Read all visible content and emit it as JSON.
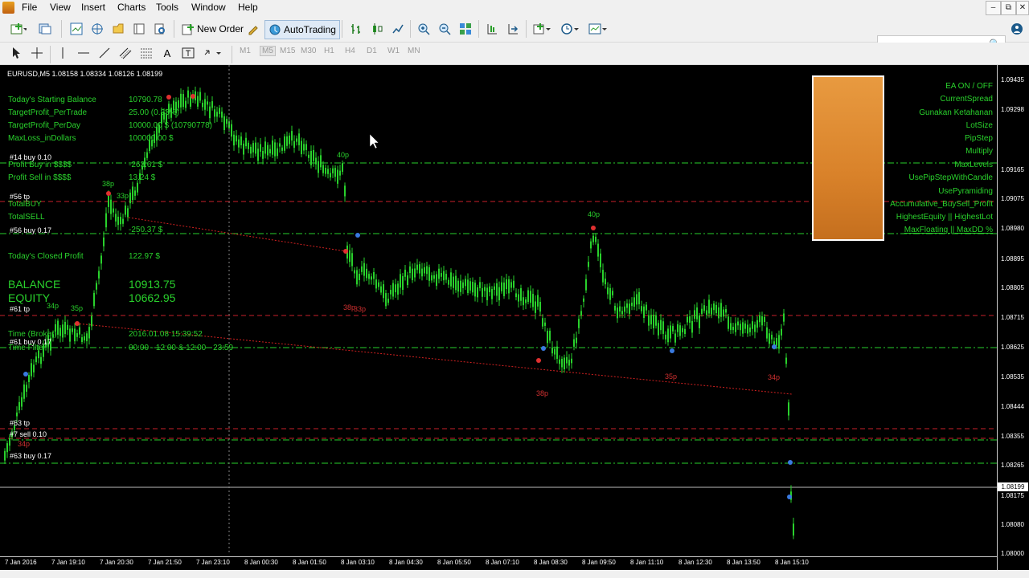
{
  "menu": {
    "items": [
      "File",
      "View",
      "Insert",
      "Charts",
      "Tools",
      "Window",
      "Help"
    ]
  },
  "window_controls": {
    "minimize": "–",
    "restore": "⧉",
    "close": "✕"
  },
  "toolbar": {
    "new_order": "New Order",
    "autotrading": "AutoTrading",
    "timeframes": [
      "M1",
      "M5",
      "M15",
      "M30",
      "H1",
      "H4",
      "D1",
      "W1",
      "MN"
    ]
  },
  "search": {
    "placeholder": ""
  },
  "chart": {
    "header": "EURUSD,M5  1.08158 1.08334 1.08126 1.08199",
    "info": [
      {
        "label": "Today's Starting Balance",
        "value": "10790.78"
      },
      {
        "label": "TargetProfit_PerTrade",
        "value": "25.00 (0.23%)"
      },
      {
        "label": "TargetProfit_PerDay",
        "value": "10000.00 $ (10790778)"
      },
      {
        "label": "MaxLoss_inDollars",
        "value": "100000.00 $"
      }
    ],
    "profit_buy": {
      "label": "Profit Buy in $$$$",
      "value": "-263.61 $"
    },
    "profit_sell": {
      "label": "Profit Sell in $$$$",
      "value": "13.24 $"
    },
    "total_buy": "TotalBUY",
    "total_sell": "TotalSELL",
    "total_value": "-250.37 $",
    "closed_profit": {
      "label": "Today's Closed Profit",
      "value": "122.97 $"
    },
    "balance": {
      "label": "BALANCE",
      "value": "10913.75"
    },
    "equity": {
      "label": "EQUITY",
      "value": "10662.95"
    },
    "time_broker": {
      "label": "Time (Broker)",
      "value": "2016.01.08 15:39:52"
    },
    "time_filter": {
      "label": "Time Filter",
      "value": "00:00 - 12:00 & 12:00 - 23:59"
    },
    "order_labels": [
      "#14 buy 0.10",
      "#56 tp",
      "#56 buy 0.17",
      "#61 tp",
      "#61 buy 0.17",
      "#63 tp",
      "#7 sell 0.10",
      "#63 buy 0.17"
    ],
    "pip_labels": [
      "38p",
      "33p",
      "40p",
      "40p",
      "34p",
      "35p",
      "38p",
      "33p",
      "38p",
      "34p",
      "35p",
      "34p"
    ],
    "right_menu": [
      "EA ON / OFF",
      "CurrentSpread",
      "Gunakan Ketahanan",
      "LotSize",
      "PipStep",
      "Multiply",
      "MaxLevels",
      "UsePipStepWithCandle",
      "UsePyramiding",
      "Accumulative_BuySell_Profit",
      "HighestEquity || HighestLot",
      "MaxFloating ||  MaxDD %"
    ],
    "price_labels": [
      "1.09435",
      "1.09298",
      "1.09165",
      "1.09075",
      "1.08980",
      "1.08895",
      "1.08805",
      "1.08715",
      "1.08625",
      "1.08535",
      "1.08444",
      "1.08355",
      "1.08265",
      "1.08175",
      "1.08080",
      "1.08000"
    ],
    "current_price": "1.08199",
    "time_labels": [
      "7 Jan 2016",
      "7 Jan 19:10",
      "7 Jan 20:30",
      "7 Jan 21:50",
      "7 Jan 23:10",
      "8 Jan 00:30",
      "8 Jan 01:50",
      "8 Jan 03:10",
      "8 Jan 04:30",
      "8 Jan 05:50",
      "8 Jan 07:10",
      "8 Jan 08:30",
      "8 Jan 09:50",
      "8 Jan 11:10",
      "8 Jan 12:30",
      "8 Jan 13:50",
      "8 Jan 15:10"
    ],
    "colors": {
      "bg": "#000000",
      "candles": "#29d12c",
      "text": "#29d12c",
      "red_line": "#c8202a",
      "green_dash": "#29d12c",
      "panel": "#e08c34"
    }
  }
}
